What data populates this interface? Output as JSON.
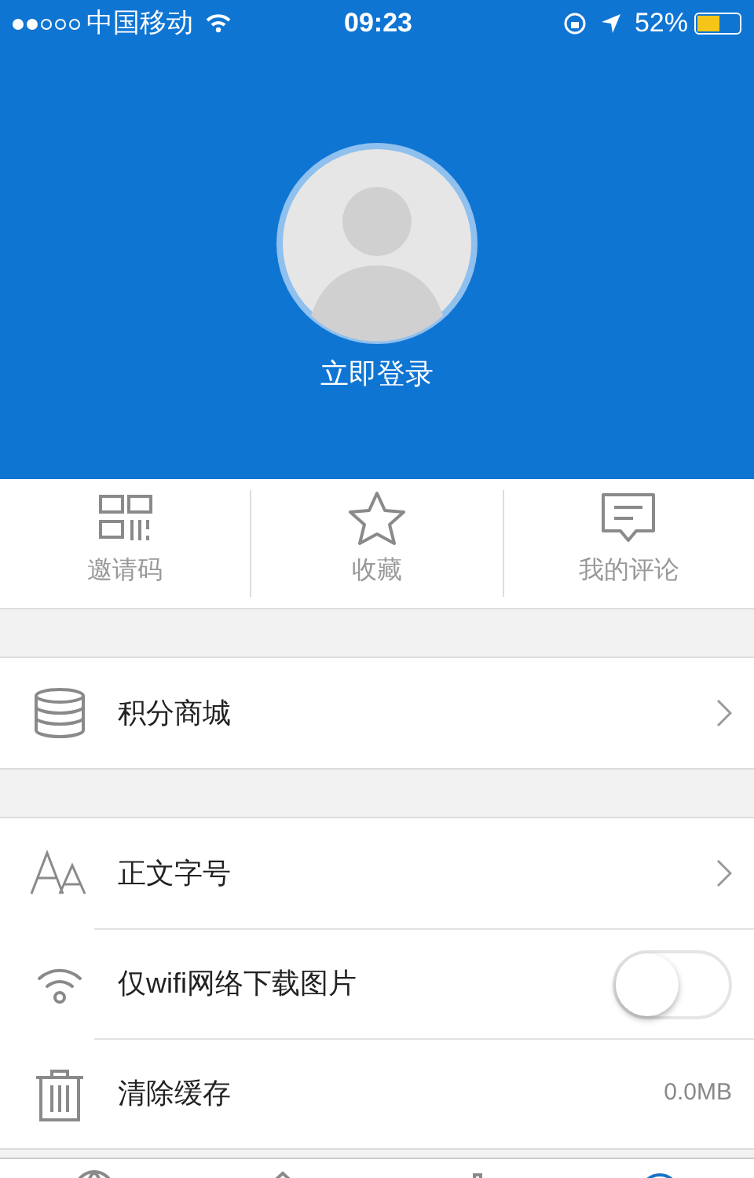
{
  "status_bar": {
    "carrier": "中国移动",
    "time": "09:23",
    "battery": "52%"
  },
  "profile": {
    "login": "立即登录"
  },
  "shortcuts": [
    {
      "kind": "qr",
      "label": "邀请码"
    },
    {
      "kind": "star",
      "label": "收藏"
    },
    {
      "kind": "comment",
      "label": "我的评论"
    }
  ],
  "groups": [
    [
      {
        "kind": "link",
        "label": "积分商城"
      }
    ],
    [
      {
        "kind": "link",
        "label": "正文字号"
      },
      {
        "kind": "toggle",
        "label": "仅wifi网络下载图片",
        "on": false
      },
      {
        "kind": "value",
        "label": "清除缓存",
        "value": "0.0MB"
      }
    ]
  ],
  "tab_bar": [
    {
      "selected": false
    },
    {
      "selected": false
    },
    {
      "selected": false
    },
    {
      "selected": true
    }
  ]
}
